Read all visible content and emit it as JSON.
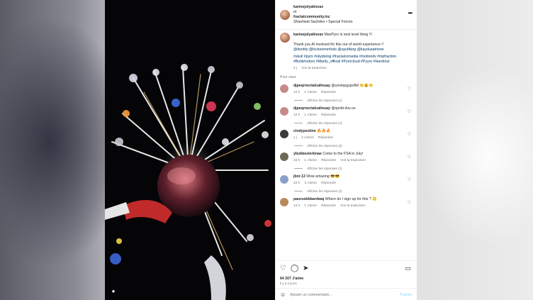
{
  "post": {
    "username": "karinejolyalinoax",
    "and": "et",
    "coauthor": "fractalcommunity.inc",
    "music": "Shashwat Sachdev • Special Forces",
    "more_icon": "more-dots-icon"
  },
  "caption": {
    "username": "karinejolyalinoax",
    "text": "MaxPyro is next level thing !!!",
    "dot": ".",
    "thanks": "Thank you AI involved for this out of world experience !!",
    "mentions": "@dentity @lockeemerfods @ayutlking @kayduaatrione",
    "hashtags": "#skull #pyro #skydiving #fractalcomedia #motiondv #mpfraction #Butikmotors #Marity_official #Pyrocloud #Pyyro #Hardrout",
    "time": "2 j",
    "translate": "Voir la traduction"
  },
  "language": "Pour vous",
  "comments": [
    {
      "user": "djpeqrnoctalcalinuay",
      "text": "@unstopgypoftiil 👏😮👏",
      "time": "12 h",
      "likes": "2 J'aime",
      "reply": "Répondre",
      "translate": "",
      "show_replies": "Afficher les réponses (1)"
    },
    {
      "user": "djpeqrnoctalcalinuay",
      "text": "@spotti.dvu.vs",
      "time": "12 h",
      "likes": "2 J'aime",
      "reply": "Répondre",
      "translate": "",
      "show_replies": "Afficher les réponses (1)"
    },
    {
      "user": "cindypeoline",
      "text": "🔥🔥🔥",
      "time": "1 j",
      "likes": "2 J'aime",
      "reply": "Répondre",
      "translate": "",
      "show_replies": "Afficher les réponses (2)"
    },
    {
      "user": "ybukbesterbnae",
      "text": "Come to the FSA in July!",
      "time": "23 h",
      "likes": "1 J'aime",
      "reply": "Répondre",
      "translate": "Voir la traduction",
      "show_replies": "Afficher les réponses (1)"
    },
    {
      "user": "jbnr.13",
      "text": "Wow amazing 😎😎",
      "time": "23 h",
      "likes": "3 J'aime",
      "reply": "Répondre",
      "translate": "",
      "show_replies": "Afficher les réponses (2)"
    },
    {
      "user": "paurusbbbardwaj",
      "text": "Where do I sign up for this ? 😳",
      "time": "14 h",
      "likes": "1 J'aime",
      "reply": "Répondre",
      "translate": "Voir la traduction",
      "show_replies": ""
    }
  ],
  "stats": {
    "likes": "64 207 J'aime",
    "date": "Il y a 2 jours"
  },
  "add_comment": {
    "placeholder": "Ajouter un commentaire...",
    "publish": "Publier"
  }
}
